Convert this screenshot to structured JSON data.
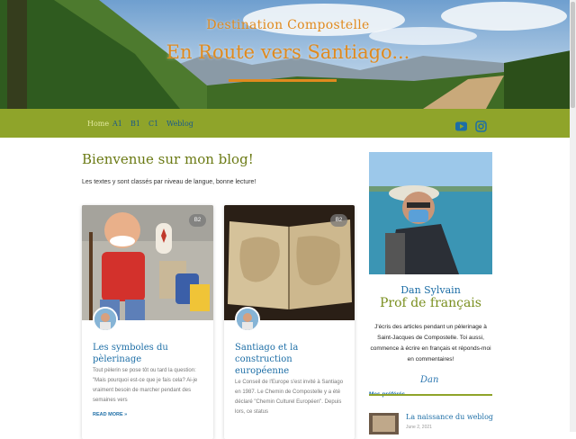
{
  "header": {
    "subtitle": "Destination Compostelle",
    "title": "En Route vers Santiago..."
  },
  "nav": {
    "items": [
      "Home",
      "A1",
      "B1",
      "C1",
      "Weblog"
    ]
  },
  "colors": {
    "accent_green": "#8fa42a",
    "accent_orange": "#e08a1e",
    "link_blue": "#1d6ea6"
  },
  "social": {
    "icons": [
      "youtube-icon",
      "instagram-icon"
    ]
  },
  "main": {
    "heading": "Bienvenue sur mon blog!",
    "intro": "Les textes y sont classés par niveau de langue, bonne lecture!",
    "cards": [
      {
        "badge": "B2",
        "title": "Les symboles du pèlerinage",
        "excerpt": "Tout pèlerin se pose tôt ou tard la question: \"Mais pourquoi est-ce que je fais cela? Ai-je vraiment besoin de marcher pendant des semaines vers",
        "more": "READ MORE »"
      },
      {
        "badge": "B2",
        "title": "Santiago et la construction européenne",
        "excerpt": "Le Conseil de l'Europe s'est invité à Santiago en 1987. Le Chemin de Compostelle y a été déclaré \"Chemin Culturel Européen\". Depuis lors, ce status",
        "more": ""
      }
    ]
  },
  "sidebar": {
    "name": "Dan Sylvain",
    "role": "Prof de français",
    "bio": "J'écris des articles pendant un pèlerinage à Saint-Jacques de Compostelle. Toi aussi, commence à écrire en français et réponds-moi en commentaires!",
    "signature": "Dan",
    "favorites_header": "Mes préférés",
    "favorites": [
      {
        "title": "La naissance du weblog",
        "date": "June 2, 2021"
      }
    ]
  }
}
